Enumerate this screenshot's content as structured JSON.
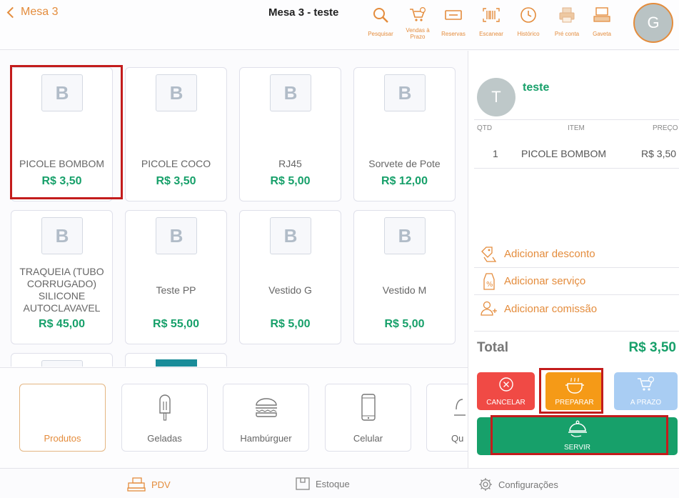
{
  "header": {
    "back_label": "Mesa 3",
    "title": "Mesa 3 - teste",
    "avatar_initial": "G",
    "tools": [
      {
        "label": "Pesquisar",
        "icon": "search-icon"
      },
      {
        "label": "Vendas à Prazo",
        "icon": "cart-clock-icon"
      },
      {
        "label": "Reservas",
        "icon": "reservation-icon"
      },
      {
        "label": "Escanear",
        "icon": "barcode-icon"
      },
      {
        "label": "Histórico",
        "icon": "clock-icon"
      },
      {
        "label": "Pré conta",
        "icon": "printer-icon"
      },
      {
        "label": "Gaveta",
        "icon": "drawer-icon"
      }
    ]
  },
  "products": [
    {
      "placeholder": "B",
      "name": "PICOLE BOMBOM",
      "price": "R$ 3,50"
    },
    {
      "placeholder": "B",
      "name": "PICOLE COCO",
      "price": "R$ 3,50"
    },
    {
      "placeholder": "B",
      "name": "RJ45",
      "price": "R$ 5,00"
    },
    {
      "placeholder": "B",
      "name": "Sorvete de Pote",
      "price": "R$ 12,00"
    },
    {
      "placeholder": "B",
      "name": "TRAQUEIA (TUBO CORRUGADO) SILICONE AUTOCLAVAVEL",
      "price": "R$ 45,00"
    },
    {
      "placeholder": "B",
      "name": "Teste PP",
      "price": "R$ 55,00"
    },
    {
      "placeholder": "B",
      "name": "Vestido G",
      "price": "R$ 5,00"
    },
    {
      "placeholder": "B",
      "name": "Vestido M",
      "price": "R$ 5,00"
    }
  ],
  "categories": [
    {
      "label": "Produtos",
      "icon": "none",
      "active": true
    },
    {
      "label": "Geladas",
      "icon": "popsicle-icon"
    },
    {
      "label": "Hambúrguer",
      "icon": "burger-icon"
    },
    {
      "label": "Celular",
      "icon": "phone-icon"
    },
    {
      "label": "Qu",
      "icon": "lamp-icon"
    }
  ],
  "order": {
    "customer_initial": "T",
    "customer_name": "teste",
    "columns": {
      "qty": "QTD",
      "item": "ITEM",
      "price": "PREÇO"
    },
    "items": [
      {
        "qty": "1",
        "name": "PICOLE BOMBOM",
        "price": "R$ 3,50"
      }
    ],
    "actions": [
      {
        "label": "Adicionar desconto",
        "icon": "discount-icon"
      },
      {
        "label": "Adicionar serviço",
        "icon": "percent-tag-icon"
      },
      {
        "label": "Adicionar comissão",
        "icon": "user-plus-icon"
      }
    ],
    "total_label": "Total",
    "total_value": "R$ 3,50",
    "buttons": {
      "cancel": "CANCELAR",
      "prepare": "PREPARAR",
      "on_credit": "A PRAZO",
      "serve": "SERVIR"
    }
  },
  "nav": {
    "pdv": "PDV",
    "stock": "Estoque",
    "settings": "Configurações"
  },
  "colors": {
    "accent": "#e48c3c",
    "green": "#17a06a",
    "cancel": "#f04a45",
    "prepare": "#f59a17",
    "credit": "#a9cdf3",
    "serve": "#17a06a",
    "highlight": "#c31c1c"
  }
}
